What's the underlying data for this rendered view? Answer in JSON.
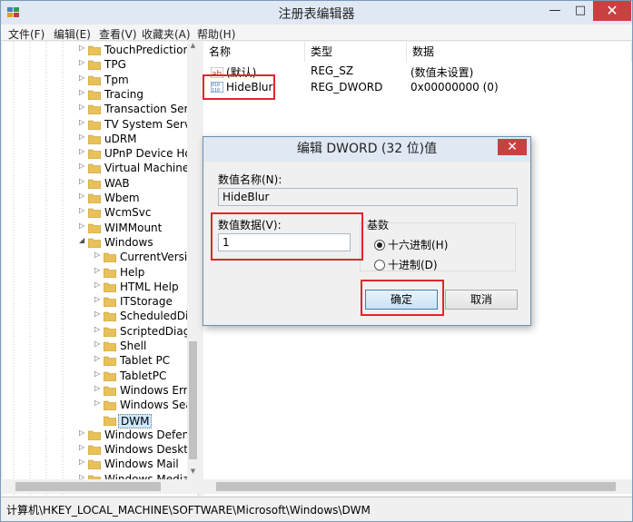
{
  "window": {
    "title": "注册表编辑器",
    "min_label": "—",
    "max_label": "□",
    "close_label": "✕"
  },
  "menu": [
    "文件(F)",
    "编辑(E)",
    "查看(V)",
    "收藏夹(A)",
    "帮助(H)"
  ],
  "tree": {
    "items": [
      {
        "label": "TouchPrediction",
        "level": 1
      },
      {
        "label": "TPG",
        "level": 1
      },
      {
        "label": "Tpm",
        "level": 1
      },
      {
        "label": "Tracing",
        "level": 1
      },
      {
        "label": "Transaction Serv",
        "level": 1
      },
      {
        "label": "TV System Servic",
        "level": 1
      },
      {
        "label": "uDRM",
        "level": 1
      },
      {
        "label": "UPnP Device Hos",
        "level": 1
      },
      {
        "label": "Virtual Machine",
        "level": 1
      },
      {
        "label": "WAB",
        "level": 1
      },
      {
        "label": "Wbem",
        "level": 1
      },
      {
        "label": "WcmSvc",
        "level": 1
      },
      {
        "label": "WIMMount",
        "level": 1
      },
      {
        "label": "Windows",
        "level": 1,
        "expanded": true
      },
      {
        "label": "CurrentVersio",
        "level": 2
      },
      {
        "label": "Help",
        "level": 2
      },
      {
        "label": "HTML Help",
        "level": 2
      },
      {
        "label": "ITStorage",
        "level": 2
      },
      {
        "label": "ScheduledDia",
        "level": 2
      },
      {
        "label": "ScriptedDiagr",
        "level": 2
      },
      {
        "label": "Shell",
        "level": 2
      },
      {
        "label": "Tablet PC",
        "level": 2
      },
      {
        "label": "TabletPC",
        "level": 2
      },
      {
        "label": "Windows Erro",
        "level": 2
      },
      {
        "label": "Windows Sea",
        "level": 2
      },
      {
        "label": "DWM",
        "level": 2,
        "selected": true
      },
      {
        "label": "Windows Defend",
        "level": 1
      },
      {
        "label": "Windows Deskto",
        "level": 1
      },
      {
        "label": "Windows Mail",
        "level": 1
      },
      {
        "label": "Windows Media",
        "level": 1
      }
    ]
  },
  "list": {
    "columns": [
      "名称",
      "类型",
      "数据"
    ],
    "rows": [
      {
        "name": "(默认)",
        "type": "REG_SZ",
        "data": "(数值未设置)",
        "icon": "string-value-icon"
      },
      {
        "name": "HideBlur",
        "type": "REG_DWORD",
        "data": "0x00000000 (0)",
        "icon": "binary-value-icon"
      }
    ]
  },
  "dialog": {
    "title": "编辑 DWORD (32 位)值",
    "close_label": "✕",
    "name_label": "数值名称(N):",
    "name_value": "HideBlur",
    "data_label": "数值数据(V):",
    "data_value": "1",
    "base_label": "基数",
    "radio_hex": "十六进制(H)",
    "radio_dec": "十进制(D)",
    "selected_base": "hex",
    "ok_label": "确定",
    "cancel_label": "取消"
  },
  "status": {
    "path": "计算机\\HKEY_LOCAL_MACHINE\\SOFTWARE\\Microsoft\\Windows\\DWM"
  },
  "colors": {
    "highlight_box": "#e0262c",
    "selection": "#cde8ff",
    "folder": "#e8c15a"
  }
}
